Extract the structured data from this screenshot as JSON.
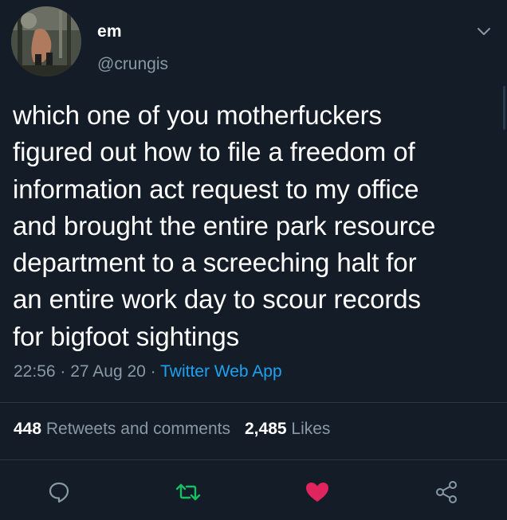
{
  "user": {
    "display_name": "em",
    "handle": "@crungis"
  },
  "tweet": {
    "lines": [
      "which one of you motherfuckers",
      "figured out how to file a freedom of",
      "information act request to my office",
      "and brought the entire park resource",
      "department to a screeching halt for",
      "an entire work day to scour records",
      "for bigfoot sightings"
    ],
    "time": "22:56",
    "sep1": " · ",
    "date": "27 Aug 20",
    "sep2": " · ",
    "source": "Twitter Web App"
  },
  "stats": {
    "retweets_count": "448",
    "retweets_label": "Retweets and comments",
    "likes_count": "2,485",
    "likes_label": "Likes"
  },
  "icons": {
    "reply": "reply-icon",
    "retweet": "retweet-icon",
    "like": "heart-icon",
    "share": "share-icon",
    "menu": "chevron-down-icon"
  },
  "colors": {
    "background": "#141d27",
    "secondary_text": "#8899a6",
    "link": "#1da1f2",
    "retweet_green": "#17bf63",
    "like_red": "#e0245e"
  }
}
